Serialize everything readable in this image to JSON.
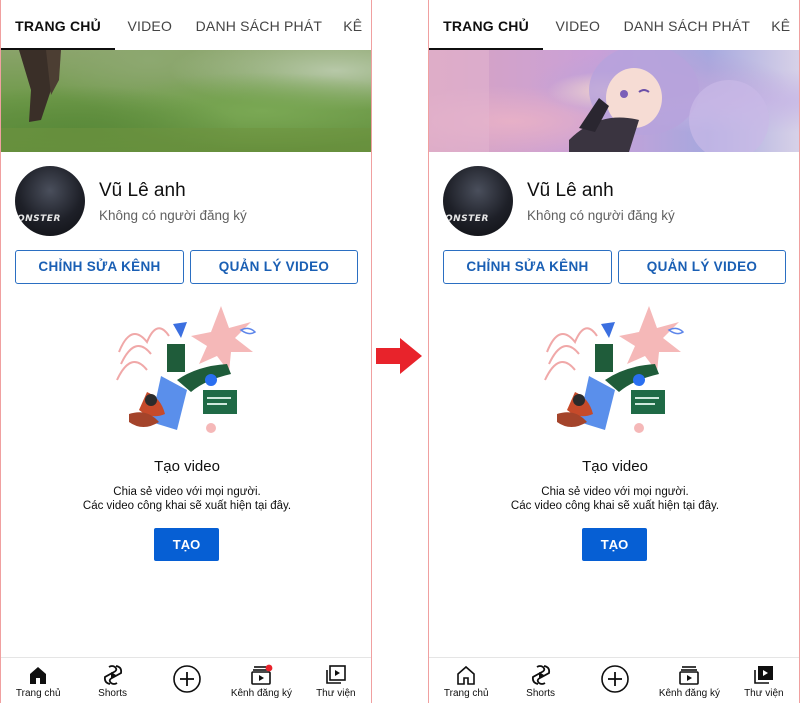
{
  "screens": [
    {
      "id": "left",
      "tabs": [
        "TRANG CHỦ",
        "VIDEO",
        "DANH SÁCH PHÁT",
        "KÊ"
      ],
      "active_tab": 0,
      "banner": "grass-photo",
      "channel": {
        "name": "Vũ Lê anh",
        "subscribers": "Không có người đăng ký",
        "avatar_text": "ONSTER"
      },
      "buttons": {
        "edit": "CHỈNH SỬA KÊNH",
        "manage": "QUẢN LÝ VIDEO"
      },
      "empty_state": {
        "title": "Tạo video",
        "line1": "Chia sẻ video với mọi người.",
        "line2": "Các video công khai sẽ xuất hiện tại đây.",
        "cta": "TẠO"
      },
      "bottom_nav": [
        {
          "label": "Trang chủ",
          "icon": "home-icon-filled"
        },
        {
          "label": "Shorts",
          "icon": "shorts-icon"
        },
        {
          "label": "",
          "icon": "create-plus-icon"
        },
        {
          "label": "Kênh đăng ký",
          "icon": "subscriptions-icon-with-dot"
        },
        {
          "label": "Thư viện",
          "icon": "library-icon"
        }
      ]
    },
    {
      "id": "right",
      "tabs": [
        "TRANG CHỦ",
        "VIDEO",
        "DANH SÁCH PHÁT",
        "KÊ"
      ],
      "active_tab": 0,
      "banner": "anime-artwork",
      "channel": {
        "name": "Vũ Lê anh",
        "subscribers": "Không có người đăng ký",
        "avatar_text": "ONSTER"
      },
      "buttons": {
        "edit": "CHỈNH SỬA KÊNH",
        "manage": "QUẢN LÝ VIDEO"
      },
      "empty_state": {
        "title": "Tạo video",
        "line1": "Chia sẻ video với mọi người.",
        "line2": "Các video công khai sẽ xuất hiện tại đây.",
        "cta": "TẠO"
      },
      "bottom_nav": [
        {
          "label": "Trang chủ",
          "icon": "home-icon-outline"
        },
        {
          "label": "Shorts",
          "icon": "shorts-icon"
        },
        {
          "label": "",
          "icon": "create-plus-icon"
        },
        {
          "label": "Kênh đăng ký",
          "icon": "subscriptions-icon"
        },
        {
          "label": "Thư viện",
          "icon": "library-icon-filled"
        }
      ]
    }
  ],
  "colors": {
    "accent_blue": "#065fd4",
    "outline_blue": "#2b6fc2",
    "arrow_red": "#e8232b",
    "notification_dot": "#e8232b"
  }
}
